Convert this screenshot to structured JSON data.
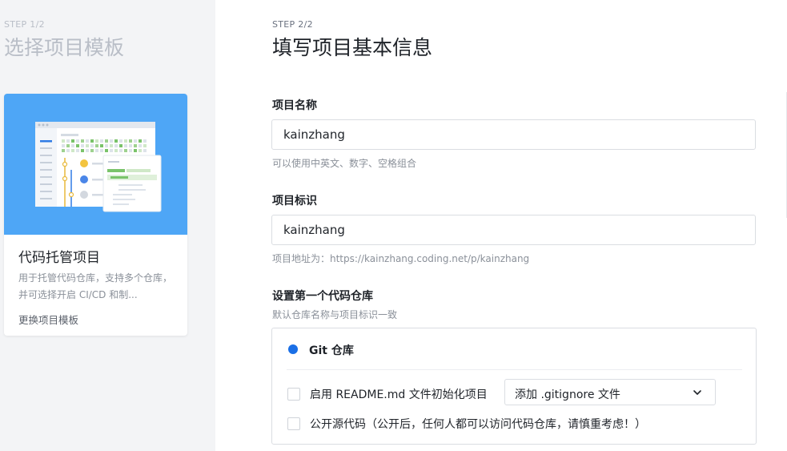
{
  "left_panel": {
    "step_label": "STEP 1/2",
    "step_title": "选择项目模板",
    "template_card": {
      "title": "代码托管项目",
      "description": "用于托管代码仓库，支持多个仓库，并可选择开启 CI/CD 和制...",
      "change_link": "更换项目模板"
    }
  },
  "main": {
    "step_label": "STEP 2/2",
    "step_title": "填写项目基本信息",
    "project_name": {
      "label": "项目名称",
      "value": "kainzhang",
      "hint": "可以使用中英文、数字、空格组合"
    },
    "project_id": {
      "label": "项目标识",
      "value": "kainzhang",
      "hint": "项目地址为：https://kainzhang.coding.net/p/kainzhang"
    },
    "first_repo": {
      "label": "设置第一个代码仓库",
      "hint": "默认仓库名称与项目标识一致",
      "repo_type": "Git 仓库",
      "readme_option": "启用 README.md 文件初始化项目",
      "gitignore_select": "添加 .gitignore 文件",
      "open_source_option": "公开源代码（公开后，任何人都可以访问代码仓库，请慎重考虑！）"
    }
  },
  "colors": {
    "accent": "#1a6fe6",
    "hero_blue": "#4ea6f6",
    "panel_gray": "#f3f4f6",
    "git_green": "#7ac36a"
  }
}
